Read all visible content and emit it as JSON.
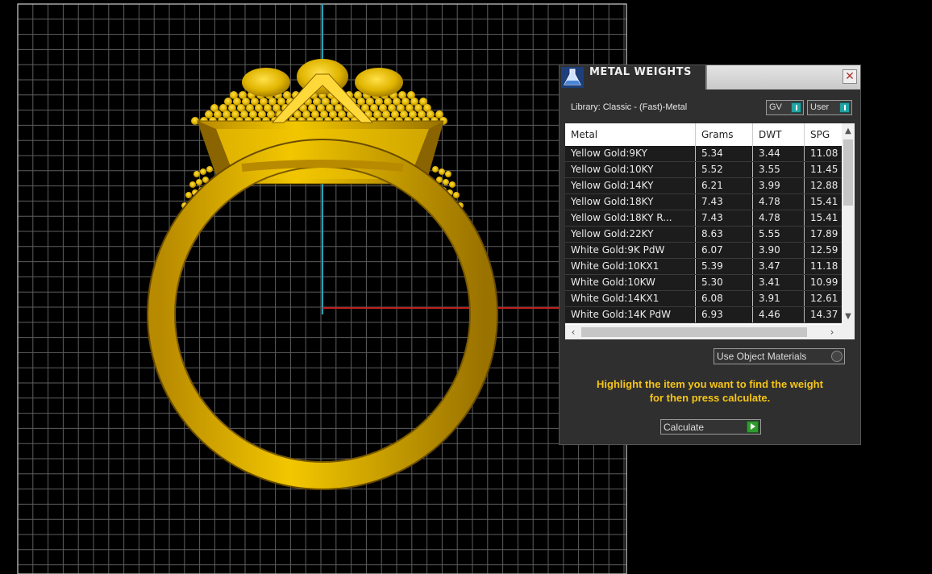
{
  "panel": {
    "title": "METAL WEIGHTS",
    "close_glyph": "✕",
    "library_label": "Library: Classic - (Fast)-Metal",
    "toggle_gv": "GV",
    "toggle_user": "User",
    "table": {
      "headers": [
        "Metal",
        "Grams",
        "DWT",
        "SPG"
      ],
      "rows": [
        [
          "Yellow Gold:9KY",
          "5.34",
          "3.44",
          "11.08"
        ],
        [
          "Yellow Gold:10KY",
          "5.52",
          "3.55",
          "11.45"
        ],
        [
          "Yellow Gold:14KY",
          "6.21",
          "3.99",
          "12.88"
        ],
        [
          "Yellow Gold:18KY",
          "7.43",
          "4.78",
          "15.41"
        ],
        [
          "Yellow Gold:18KY R...",
          "7.43",
          "4.78",
          "15.41"
        ],
        [
          "Yellow Gold:22KY",
          "8.63",
          "5.55",
          "17.89"
        ],
        [
          "White Gold:9K PdW",
          "6.07",
          "3.90",
          "12.59"
        ],
        [
          "White Gold:10KX1",
          "5.39",
          "3.47",
          "11.18"
        ],
        [
          "White Gold:10KW",
          "5.30",
          "3.41",
          "10.99"
        ],
        [
          "White Gold:14KX1",
          "6.08",
          "3.91",
          "12.61"
        ],
        [
          "White Gold:14K PdW",
          "6.93",
          "4.46",
          "14.37"
        ]
      ]
    },
    "materials_select": "Use Object Materials",
    "hint_line1": "Highlight the item you want to find the weight",
    "hint_line2": "for then press calculate.",
    "calculate_label": "Calculate"
  },
  "icons": {
    "app": "flask-icon",
    "close": "close-icon",
    "scroll_up": "chevron-up-icon",
    "scroll_down": "chevron-down-icon",
    "scroll_left": "chevron-left-icon",
    "scroll_right": "chevron-right-icon",
    "calculate": "play-icon"
  },
  "colors": {
    "viewport_bg": "#000000",
    "grid": "#6a6a6a",
    "axis_y": "#2aa0b8",
    "axis_x": "#c02020",
    "ring_gold": "#e0b400",
    "hint": "#f5c518",
    "panel_bg": "#2f2f2f"
  }
}
